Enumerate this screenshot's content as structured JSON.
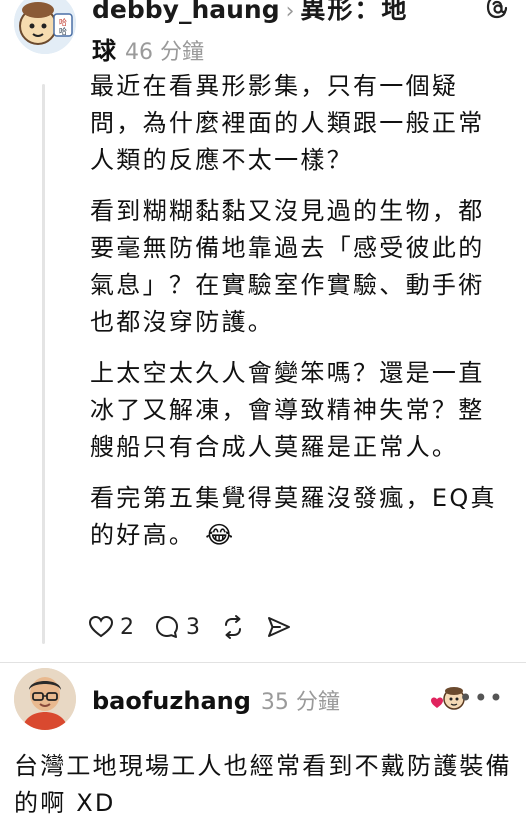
{
  "post1": {
    "username": "debby_haung",
    "topic_part1": "異形：地",
    "topic_part2": "球",
    "time": "46 分鐘",
    "paragraphs": [
      "最近在看異形影集，只有一個疑問，為什麼裡面的人類跟一般正常人類的反應不太一樣？",
      "看到糊糊黏黏又沒見過的生物，都要毫無防備地靠過去「感受彼此的氣息」？在實驗室作實驗、動手術也都沒穿防護。",
      "上太空太久人會變笨嗎？還是一直冰了又解凍，會導致精神失常？整艘船只有合成人莫羅是正常人。",
      "看完第五集覺得莫羅沒發瘋，EQ真的好高。 😂"
    ],
    "likes": "2",
    "comments": "3"
  },
  "post2": {
    "username": "baofuzhang",
    "time": "35 分鐘",
    "more": "•••",
    "text": "台灣工地現場工人也經常看到不戴防護裝備的啊 XD"
  },
  "icons": [
    "heart-icon",
    "comment-icon",
    "repost-icon",
    "share-icon",
    "threads-logo-icon",
    "more-icon"
  ]
}
